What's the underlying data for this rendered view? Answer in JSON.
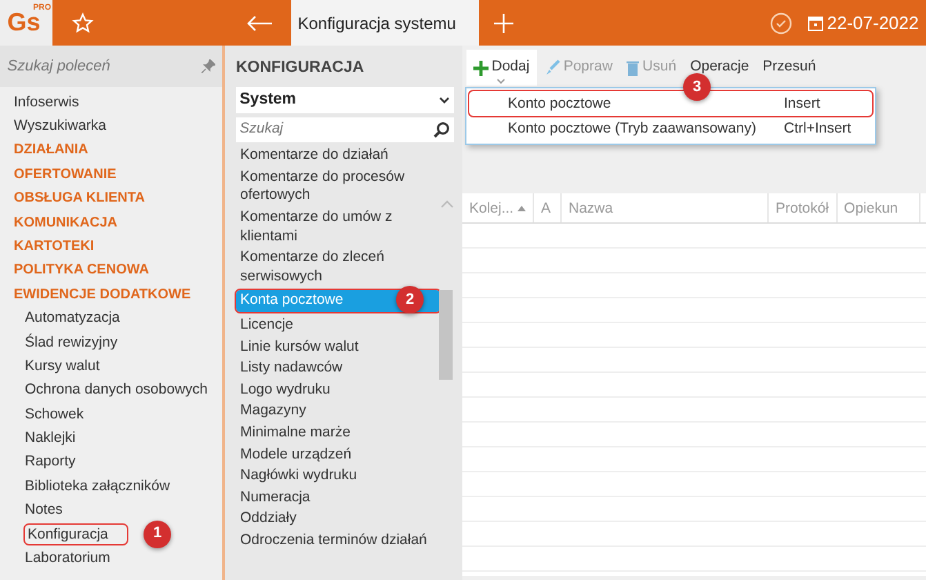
{
  "top_bar": {
    "logo": "Gs",
    "logo_sup": "PRO",
    "title": "Konfiguracja systemu",
    "date": "22-07-2022"
  },
  "sidebar": {
    "search_placeholder": "Szukaj poleceń",
    "items": [
      {
        "label": "Infoserwis",
        "kind": "link",
        "highlighted": false
      },
      {
        "label": "Wyszukiwarka",
        "kind": "link",
        "highlighted": false
      },
      {
        "label": "DZIAŁANIA",
        "kind": "section",
        "highlighted": false
      },
      {
        "label": "OFERTOWANIE",
        "kind": "section",
        "highlighted": false
      },
      {
        "label": "OBSŁUGA KLIENTA",
        "kind": "section",
        "highlighted": false
      },
      {
        "label": "KOMUNIKACJA",
        "kind": "section",
        "highlighted": false
      },
      {
        "label": "KARTOTEKI",
        "kind": "section",
        "highlighted": false
      },
      {
        "label": "POLITYKA CENOWA",
        "kind": "section",
        "highlighted": false
      },
      {
        "label": "EWIDENCJE DODATKOWE",
        "kind": "section",
        "highlighted": false
      },
      {
        "label": "Automatyzacja",
        "kind": "sub",
        "highlighted": false
      },
      {
        "label": "Ślad rewizyjny",
        "kind": "sub",
        "highlighted": false
      },
      {
        "label": "Kursy walut",
        "kind": "sub",
        "highlighted": false
      },
      {
        "label": "Ochrona danych osobowych",
        "kind": "sub",
        "highlighted": false
      },
      {
        "label": "Schowek",
        "kind": "sub",
        "highlighted": false
      },
      {
        "label": "Naklejki",
        "kind": "sub",
        "highlighted": false
      },
      {
        "label": "Raporty",
        "kind": "sub",
        "highlighted": false
      },
      {
        "label": "Biblioteka załączników",
        "kind": "sub",
        "highlighted": false
      },
      {
        "label": "Notes",
        "kind": "sub",
        "highlighted": false
      },
      {
        "label": "Konfiguracja",
        "kind": "sub",
        "highlighted": true,
        "badge": "1"
      },
      {
        "label": "Laboratorium",
        "kind": "sub",
        "highlighted": false
      }
    ]
  },
  "config_panel": {
    "title": "KONFIGURACJA",
    "category": "System",
    "search_placeholder": "Szukaj",
    "items": [
      {
        "label": "Komentarze do działań",
        "selected": false,
        "highlighted": false
      },
      {
        "label": "Komentarze do procesów ofertowych",
        "selected": false,
        "highlighted": false
      },
      {
        "label": "Komentarze do umów z klientami",
        "selected": false,
        "highlighted": false
      },
      {
        "label": "Komentarze do zleceń serwisowych",
        "selected": false,
        "highlighted": false
      },
      {
        "label": "Konta pocztowe",
        "selected": true,
        "highlighted": true,
        "badge": "2"
      },
      {
        "label": "Licencje",
        "selected": false,
        "highlighted": false
      },
      {
        "label": "Linie kursów walut",
        "selected": false,
        "highlighted": false
      },
      {
        "label": "Listy nadawców",
        "selected": false,
        "highlighted": false
      },
      {
        "label": "Logo wydruku",
        "selected": false,
        "highlighted": false
      },
      {
        "label": "Magazyny",
        "selected": false,
        "highlighted": false
      },
      {
        "label": "Minimalne marże",
        "selected": false,
        "highlighted": false
      },
      {
        "label": "Modele urządzeń",
        "selected": false,
        "highlighted": false
      },
      {
        "label": "Nagłówki wydruku",
        "selected": false,
        "highlighted": false
      },
      {
        "label": "Numeracja",
        "selected": false,
        "highlighted": false
      },
      {
        "label": "Oddziały",
        "selected": false,
        "highlighted": false
      },
      {
        "label": "Odroczenia terminów działań",
        "selected": false,
        "highlighted": false
      }
    ]
  },
  "toolbar": [
    {
      "label": "Dodaj",
      "kind": "add",
      "disabled": false
    },
    {
      "label": "Popraw",
      "kind": "edit",
      "disabled": true
    },
    {
      "label": "Usuń",
      "kind": "delete",
      "disabled": true
    },
    {
      "label": "Operacje",
      "kind": "plain",
      "disabled": false
    },
    {
      "label": "Przesuń",
      "kind": "plain",
      "disabled": false
    }
  ],
  "add_menu": [
    {
      "label": "Konto pocztowe",
      "shortcut": "Insert",
      "highlighted": true,
      "badge": "3"
    },
    {
      "label": "Konto pocztowe (Tryb zaawansowany)",
      "shortcut": "Ctrl+Insert",
      "highlighted": false
    }
  ],
  "table": {
    "columns": [
      {
        "label": "Kolej...",
        "sorted": true
      },
      {
        "label": "A",
        "sorted": false
      },
      {
        "label": "Nazwa",
        "sorted": false
      },
      {
        "label": "Protokół",
        "sorted": false
      },
      {
        "label": "Opiekun",
        "sorted": false
      }
    ]
  }
}
